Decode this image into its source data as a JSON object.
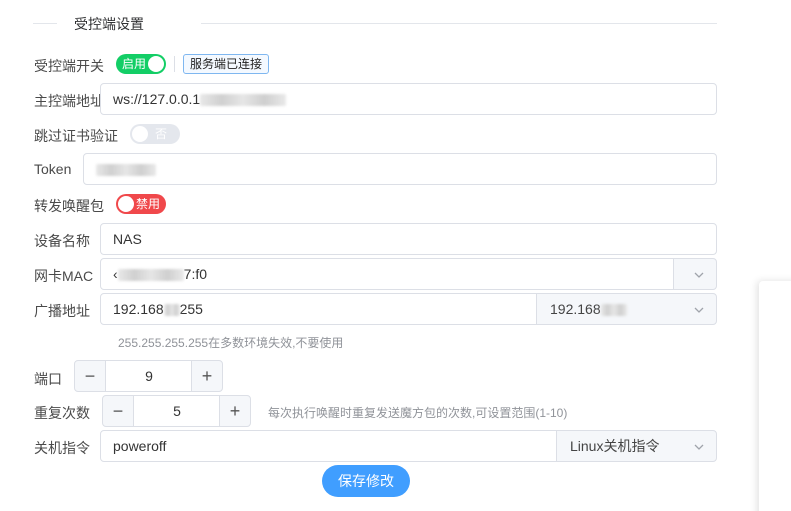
{
  "section": {
    "title": "受控端设置"
  },
  "fields": {
    "switch_label": "受控端开关",
    "switch_on_text": "启用",
    "server_status_tag": "服务端已连接",
    "master_addr_label": "主控端地址",
    "master_addr_value": "ws://127.0.0.1",
    "skip_cert_label": "跳过证书验证",
    "skip_cert_text": "否",
    "token_label": "Token",
    "forward_wake_label": "转发唤醒包",
    "forward_wake_text": "禁用",
    "device_name_label": "设备名称",
    "device_name_value": "NAS",
    "nic_mac_label": "网卡MAC",
    "nic_mac_prefix": "‹",
    "nic_mac_suffix": "7:f0",
    "broadcast_label": "广播地址",
    "broadcast_value_prefix": "192.168",
    "broadcast_value_suffix": "255",
    "broadcast_select_prefix": "192.168",
    "broadcast_hint": "255.255.255.255在多数环境失效,不要使用",
    "port_label": "端口",
    "port_value": "9",
    "repeat_label": "重复次数",
    "repeat_value": "5",
    "repeat_hint": "每次执行唤醒时重复发送魔方包的次数,可设置范围(1-10)",
    "shutdown_label": "关机指令",
    "shutdown_value": "poweroff",
    "shutdown_select": "Linux关机指令",
    "minus": "−",
    "plus": "+"
  },
  "actions": {
    "save_label": "保存修改"
  },
  "colors": {
    "switch_on": "#13ce66",
    "switch_off": "#e4e7ed",
    "switch_disabled": "#f0484b",
    "primary": "#409eff"
  }
}
